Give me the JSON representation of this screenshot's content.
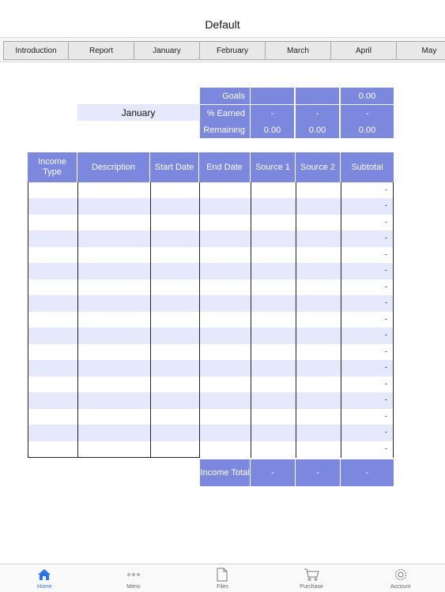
{
  "header": {
    "title": "Default"
  },
  "tabs": [
    "Introduction",
    "Report",
    "January",
    "February",
    "March",
    "April",
    "May"
  ],
  "summary": {
    "month": "January",
    "goals_label": "Goals",
    "earned_label": "% Earned",
    "remaining_label": "Remaining",
    "goals": [
      "",
      "",
      "0.00"
    ],
    "earned": [
      "-",
      "-",
      "-"
    ],
    "remaining": [
      "0.00",
      "0.00",
      "0.00"
    ]
  },
  "table": {
    "columns": [
      "Income Type",
      "Description",
      "Start Date",
      "End Date",
      "Source 1",
      "Source 2",
      "Subtotal"
    ],
    "subtotals": [
      "-",
      "-",
      "-",
      "-",
      "-",
      "-",
      "-",
      "-",
      "-",
      "-",
      "-",
      "-",
      "-",
      "-",
      "-",
      "-",
      "-"
    ],
    "total_label": "Income Total",
    "totals": [
      "-",
      "-",
      "-"
    ]
  },
  "nav": {
    "items": [
      {
        "label": "Home",
        "icon": "home-icon"
      },
      {
        "label": "Menu",
        "icon": "dots-icon"
      },
      {
        "label": "Files",
        "icon": "file-icon"
      },
      {
        "label": "Purchase",
        "icon": "cart-icon"
      },
      {
        "label": "Account",
        "icon": "gear-icon"
      }
    ]
  },
  "colors": {
    "header_blue": "#7b88dd",
    "row_lavender": "#e6e9fb",
    "active_nav": "#2f74e6"
  }
}
